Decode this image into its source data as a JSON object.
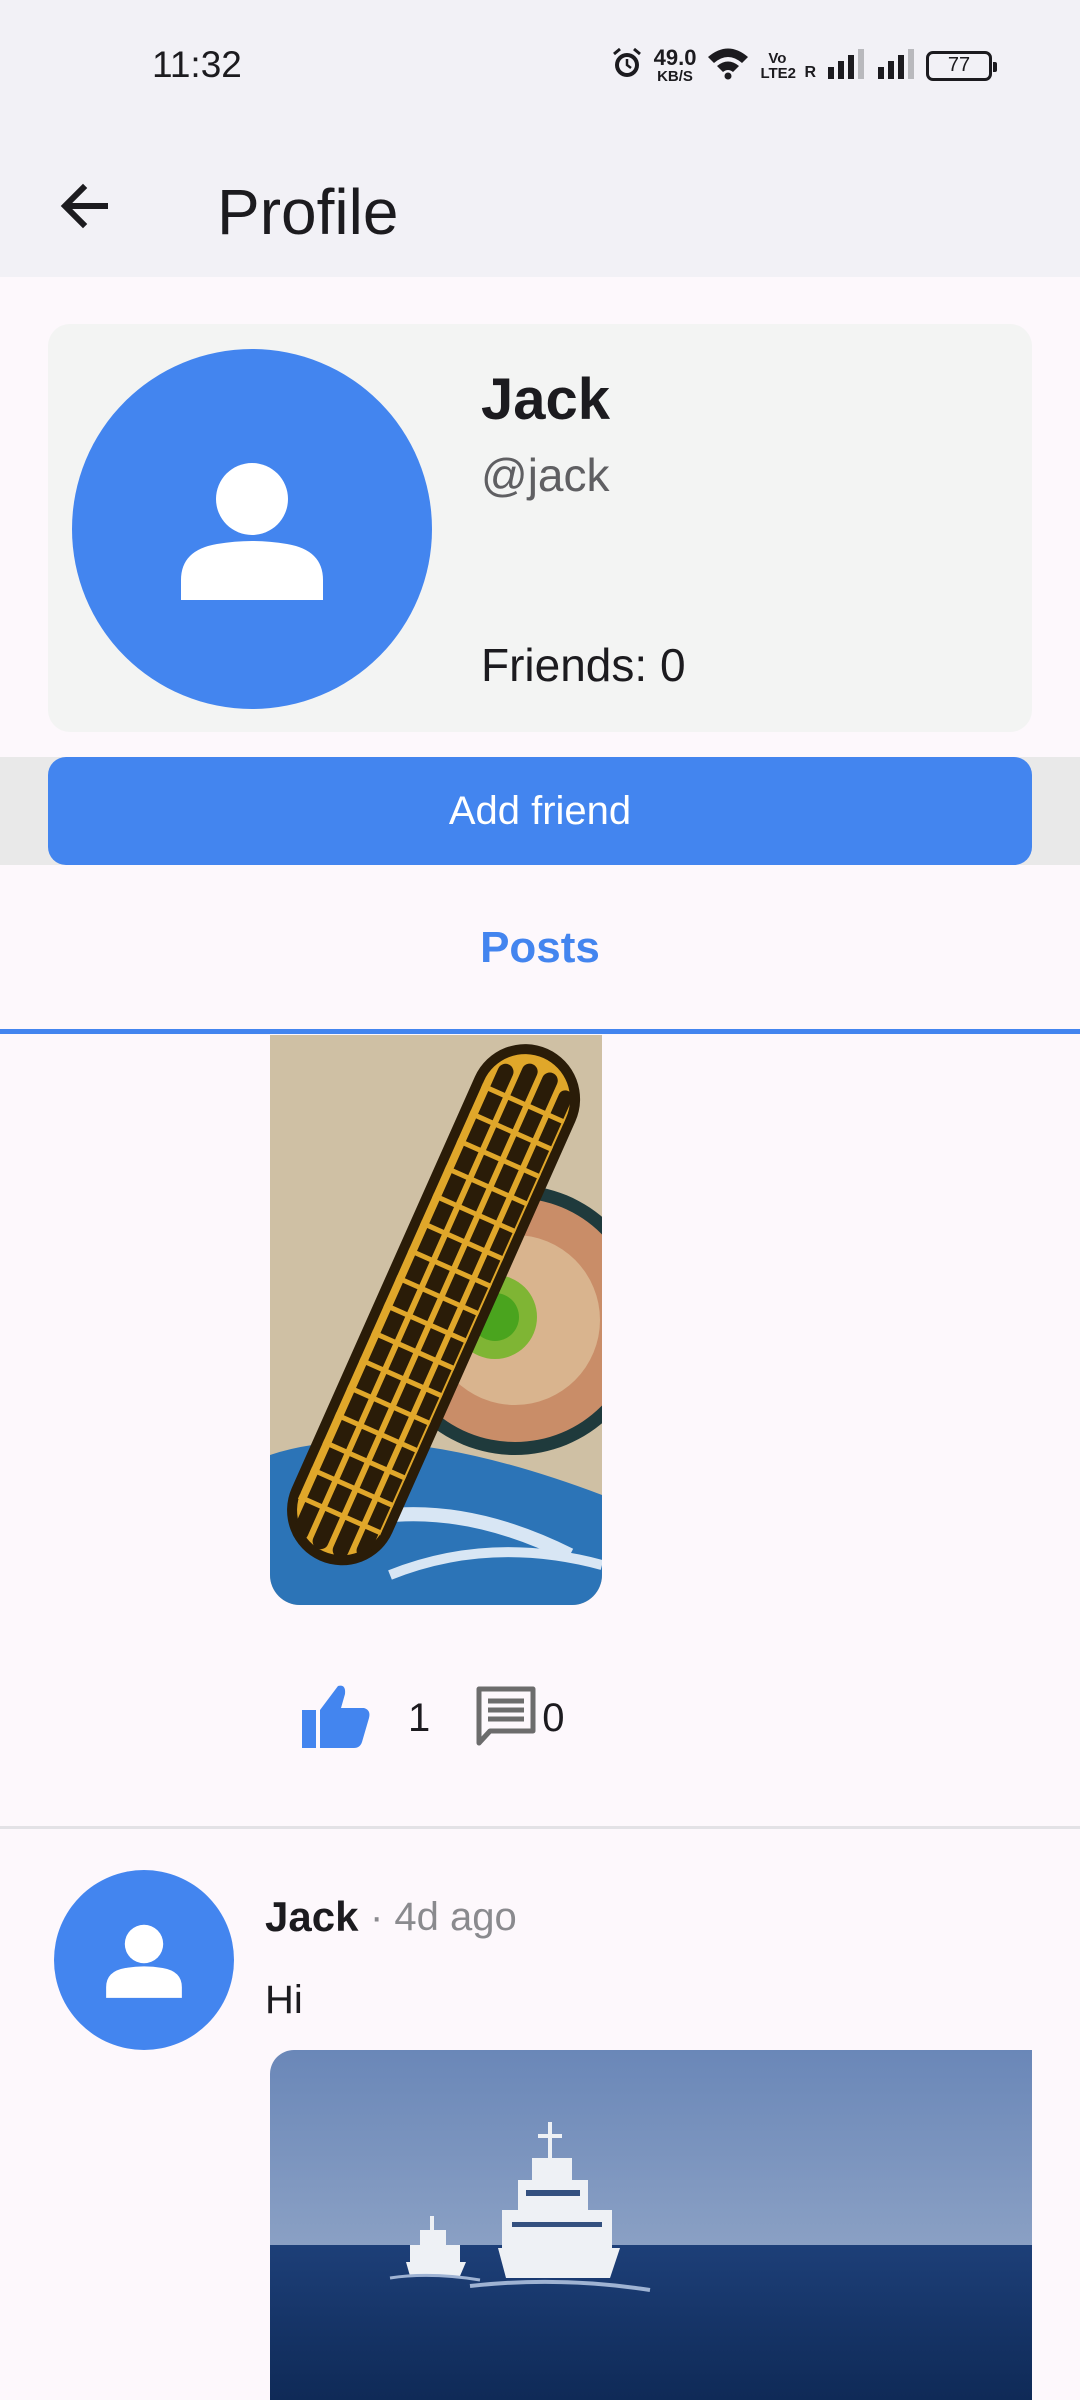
{
  "status_bar": {
    "time": "11:32",
    "net_speed_value": "49.0",
    "net_speed_unit": "KB/S",
    "volte_label": "Vo LTE2",
    "roaming_label": "R",
    "battery": "77",
    "icons": [
      "alarm-icon",
      "wifi-icon",
      "volte-icon",
      "signal-icon",
      "signal-icon",
      "battery-icon"
    ]
  },
  "app_bar": {
    "title": "Profile",
    "back_icon": "arrow-left-icon"
  },
  "profile": {
    "name": "Jack",
    "handle": "@jack",
    "friends": "Friends: 0",
    "avatar_icon": "person-icon"
  },
  "actions": {
    "add_friend_label": "Add friend"
  },
  "tabs": [
    {
      "label": "Posts",
      "active": true
    }
  ],
  "posts": [
    {
      "image_desc": "grilled-corn-on-plate",
      "likes": "1",
      "comments": "0"
    },
    {
      "author": "Jack",
      "time": "· 4d ago",
      "text": "Hi",
      "image_desc": "ships-at-sea"
    }
  ],
  "colors": {
    "accent": "#4385ef",
    "app_bar_bg": "#f2f1f6",
    "card_bg": "#f3f4f3",
    "page_bg": "#fdf8fc",
    "icon_grey": "#6c6c6c"
  }
}
